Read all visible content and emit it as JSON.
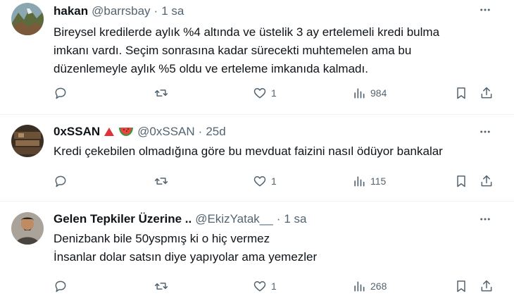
{
  "icons": {
    "reply": "reply-icon",
    "retweet": "retweet-icon",
    "like": "heart-icon",
    "views": "views-icon",
    "bookmark": "bookmark-icon",
    "share": "share-icon",
    "more": "more-icon"
  },
  "colors": {
    "text": "#0f1419",
    "secondary": "#536471",
    "divider": "#eff3f4"
  },
  "tweets": [
    {
      "name": "hakan",
      "handle": "@barrsbay",
      "separator": "·",
      "time": "1 sa",
      "lines": [
        "Bireysel kredilerde aylık %4 altında ve üstelik 3 ay ertelemeli kredi bulma",
        "imkanı vardı. Seçim sonrasına kadar sürecekti muhtemelen ama bu",
        "düzenlemeyle aylık %5 oldu ve erteleme imkanıda kalmadı."
      ],
      "likes": "1",
      "views": "984"
    },
    {
      "name": "0xSSAN",
      "emoji": [
        "red-triangle",
        "watermelon"
      ],
      "handle": "@0xSSAN",
      "separator": "·",
      "time": "25d",
      "lines": [
        "Kredi çekebilen olmadığına göre bu mevduat faizini nasıl ödüyor bankalar"
      ],
      "likes": "1",
      "views": "115"
    },
    {
      "name": "Gelen Tepkiler Üzerine ..",
      "handle": "@EkizYatak__",
      "separator": "·",
      "time": "1 sa",
      "lines": [
        "Denizbank bile 50yspmış ki o hiç vermez",
        "İnsanlar dolar satsın diye yapıyolar ama yemezler"
      ],
      "likes": "1",
      "views": "268"
    }
  ]
}
